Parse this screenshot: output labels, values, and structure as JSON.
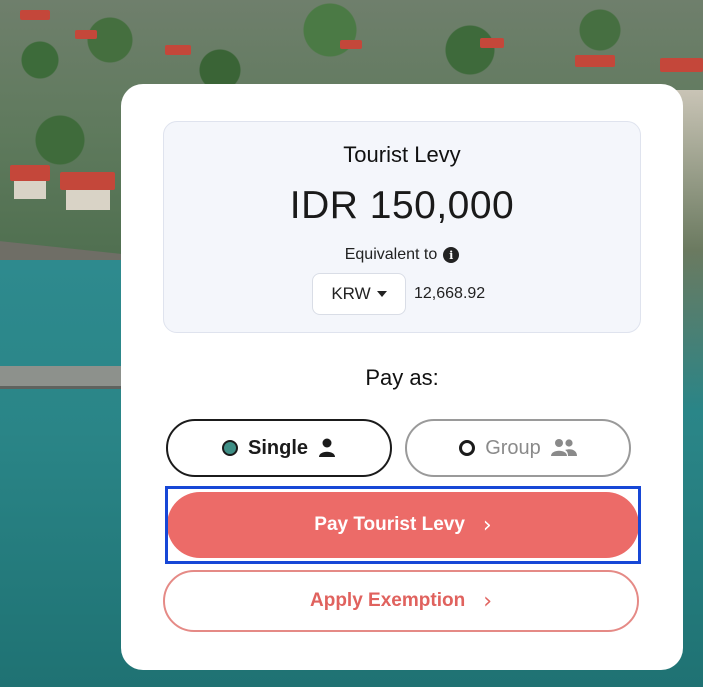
{
  "levy": {
    "title": "Tourist Levy",
    "amount": "IDR 150,000",
    "equivalent_label": "Equivalent to",
    "info_icon": "i",
    "currency": "KRW",
    "converted_value": "12,668.92"
  },
  "pay_as": {
    "label": "Pay as:",
    "options": [
      {
        "label": "Single",
        "icon": "person-icon",
        "selected": true
      },
      {
        "label": "Group",
        "icon": "people-icon",
        "selected": false
      }
    ]
  },
  "actions": {
    "pay_label": "Pay Tourist Levy",
    "exemption_label": "Apply Exemption",
    "chevron": "›"
  },
  "colors": {
    "primary": "#ec6b68",
    "radio_selected": "#3f8f86",
    "focus": "#1747d6"
  }
}
